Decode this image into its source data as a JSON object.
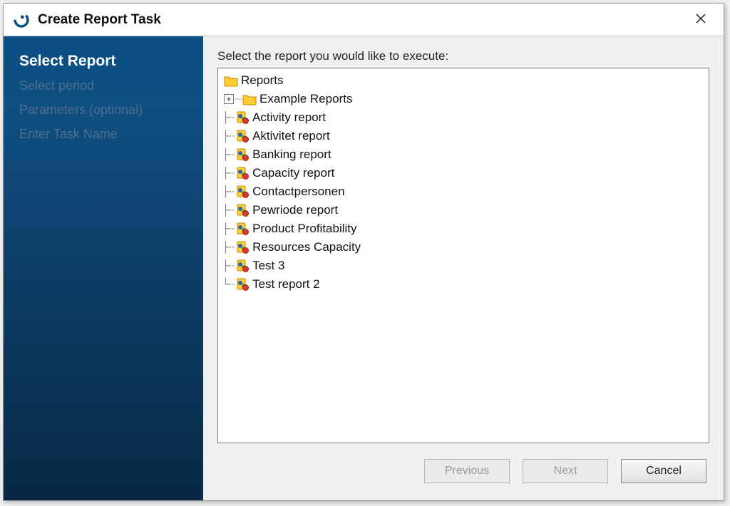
{
  "window": {
    "title": "Create Report Task"
  },
  "sidebar": {
    "steps": [
      {
        "label": "Select Report",
        "active": true
      },
      {
        "label": "Select period",
        "active": false
      },
      {
        "label": "Parameters (optional)",
        "active": false
      },
      {
        "label": "Enter Task Name",
        "active": false
      }
    ]
  },
  "main": {
    "instruction": "Select the report you would like to execute:"
  },
  "tree": {
    "root": {
      "label": "Reports",
      "type": "folder",
      "children": [
        {
          "label": "Example Reports",
          "type": "folder",
          "expandable": true
        },
        {
          "label": "Activity report",
          "type": "report"
        },
        {
          "label": "Aktivitet report",
          "type": "report"
        },
        {
          "label": "Banking report",
          "type": "report"
        },
        {
          "label": "Capacity report",
          "type": "report"
        },
        {
          "label": "Contactpersonen",
          "type": "report"
        },
        {
          "label": "Pewriode report",
          "type": "report"
        },
        {
          "label": "Product Profitability",
          "type": "report"
        },
        {
          "label": "Resources Capacity",
          "type": "report"
        },
        {
          "label": "Test 3",
          "type": "report"
        },
        {
          "label": "Test report 2",
          "type": "report"
        }
      ]
    }
  },
  "buttons": {
    "previous": {
      "label": "Previous",
      "enabled": false
    },
    "next": {
      "label": "Next",
      "enabled": false
    },
    "cancel": {
      "label": "Cancel",
      "enabled": true
    }
  },
  "expander_glyph": "+"
}
